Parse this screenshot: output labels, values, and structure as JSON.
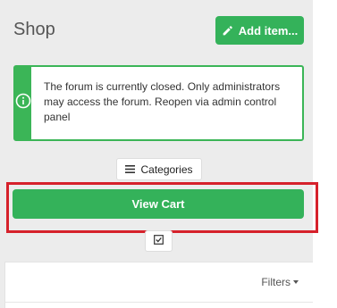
{
  "header": {
    "title": "Shop",
    "add_item_label": "Add item..."
  },
  "alert": {
    "message": "The forum is currently closed. Only administrators may access the forum. Reopen via admin control panel",
    "icon": "info-icon"
  },
  "toolbar": {
    "categories_label": "Categories",
    "view_cart_label": "View Cart",
    "select_icon": "checkbox-icon"
  },
  "panel": {
    "filters_label": "Filters"
  },
  "colors": {
    "accent": "#34b25a",
    "highlight": "#d6212b"
  }
}
